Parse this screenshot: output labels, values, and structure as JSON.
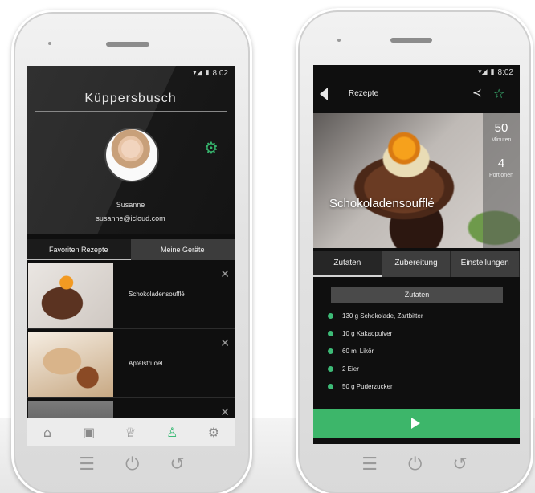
{
  "left_phone": {
    "status": {
      "time": "8:02"
    },
    "brand": "Küppersbusch",
    "profile": {
      "name": "Susanne",
      "email": "susanne@icloud.com"
    },
    "tabs": [
      {
        "label": "Favoriten Rezepte",
        "active": true
      },
      {
        "label": "Meine Geräte",
        "active": false
      }
    ],
    "favorites": [
      {
        "title": "Schokoladensoufflé"
      },
      {
        "title": "Apfelstrudel"
      },
      {
        "title": ""
      }
    ],
    "bottom_nav": [
      {
        "icon": "home-icon",
        "active": false
      },
      {
        "icon": "appliance-icon",
        "active": false
      },
      {
        "icon": "chef-hat-icon",
        "active": false
      },
      {
        "icon": "user-icon",
        "active": true
      },
      {
        "icon": "settings-gears-icon",
        "active": false
      }
    ]
  },
  "right_phone": {
    "status": {
      "time": "8:02"
    },
    "header": {
      "title": "Rezepte"
    },
    "recipe": {
      "title": "Schokoladensoufflé",
      "minutes_value": "50",
      "minutes_label": "Minuten",
      "portions_value": "4",
      "portions_label": "Portionen"
    },
    "tabs": [
      {
        "label": "Zutaten",
        "active": true
      },
      {
        "label": "Zubereitung",
        "active": false
      },
      {
        "label": "Einstellungen",
        "active": false
      }
    ],
    "ingredients_header": "Zutaten",
    "ingredients": [
      "130 g Schokolade, Zartbitter",
      "10 g Kakaopulver",
      "60 ml Likör",
      "2 Eier",
      "50 g Puderzucker"
    ]
  },
  "colors": {
    "accent_green": "#3dbb77",
    "screen_bg": "#0f0f0f"
  }
}
